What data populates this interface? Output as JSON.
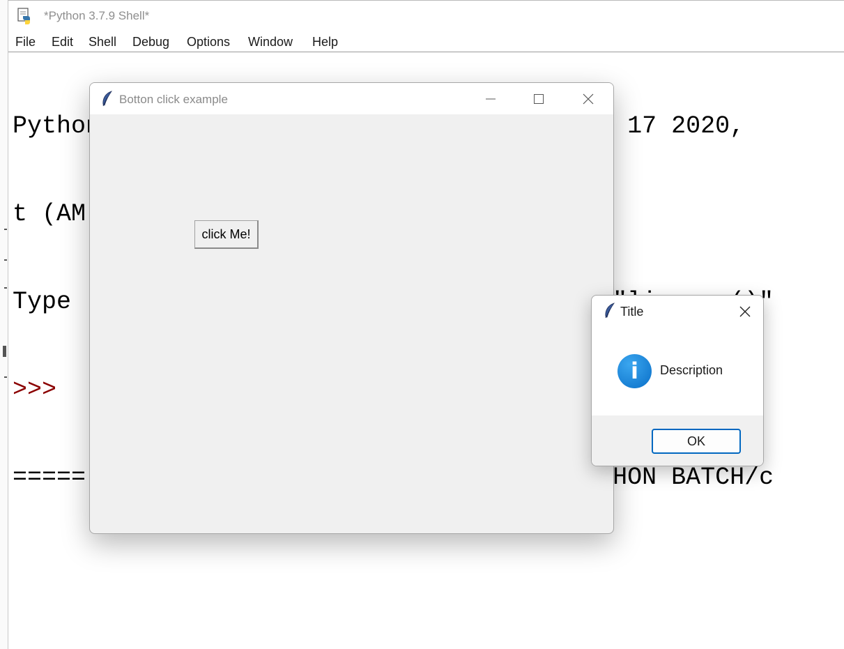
{
  "shell": {
    "title": "*Python 3.7.9 Shell*",
    "menu": [
      "File",
      "Edit",
      "Shell",
      "Debug",
      "Options",
      "Window",
      "Help"
    ],
    "console_lines": [
      "Python 3.7.9 (tags/v3.7.9:13c94747c7, Aug 17 2020,",
      "t (AM",
      "Type                                  or \"license()\"",
      ">>>",
      "=====                                 PYTHON BATCH/c"
    ]
  },
  "tk_window": {
    "title": "Botton click example",
    "button_label": "click Me!"
  },
  "dialog": {
    "title": "Title",
    "message": "Description",
    "icon": "info-icon",
    "icon_glyph": "i",
    "ok_label": "OK",
    "accent_color": "#0067c0"
  },
  "colors": {
    "prompt": "#8b0000",
    "info_icon": "#0a78d4"
  }
}
